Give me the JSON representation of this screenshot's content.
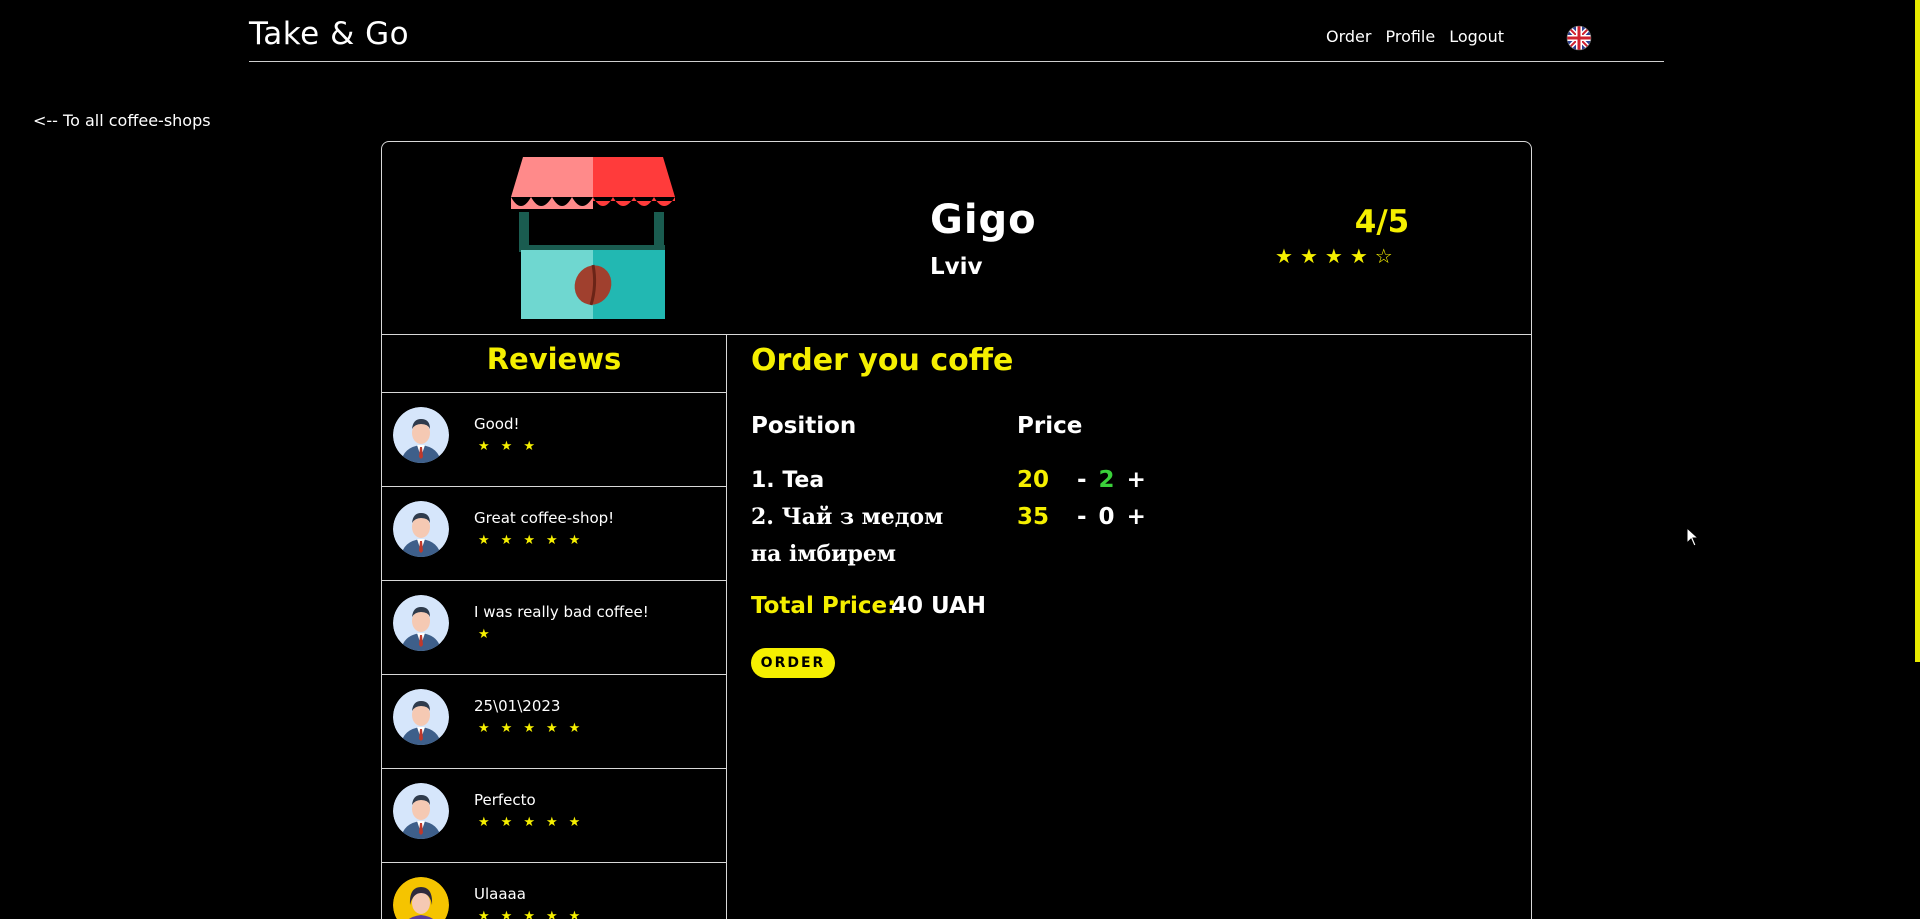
{
  "header": {
    "brand": "Take & Go",
    "nav": [
      "Order",
      "Profile",
      "Logout"
    ],
    "language_icon": "uk-flag-icon"
  },
  "back_link": "<-- To all coffee-shops",
  "shop": {
    "name": "Gigo",
    "city": "Lviv",
    "rating_text": "4/5",
    "rating_value": 4,
    "rating_max": 5,
    "illustration": "coffee-stall-icon"
  },
  "reviews": {
    "title": "Reviews",
    "items": [
      {
        "text": "Good!",
        "stars": 3,
        "avatar": "man-avatar"
      },
      {
        "text": "Great coffee-shop!",
        "stars": 5,
        "avatar": "man-avatar"
      },
      {
        "text": "I was really bad coffee!",
        "stars": 1,
        "avatar": "man-avatar"
      },
      {
        "text": "25\\01\\2023",
        "stars": 5,
        "avatar": "man-avatar"
      },
      {
        "text": "Perfecto",
        "stars": 5,
        "avatar": "man-avatar"
      },
      {
        "text": "Ulaaaa",
        "stars": 5,
        "avatar": "woman-avatar"
      }
    ]
  },
  "order": {
    "title": "Order you coffe",
    "col_position": "Position",
    "col_price": "Price",
    "items": [
      {
        "name": "1. Tea",
        "price": "20",
        "qty": "2",
        "minus": "-",
        "plus": "+"
      },
      {
        "name": "2. Чай з медом на імбирем",
        "price": "35",
        "qty": "0",
        "minus": "-",
        "plus": "+"
      }
    ],
    "total_label": "Total Price:",
    "total_value": "40 UAH",
    "order_button": "ORDER"
  },
  "colors": {
    "accent": "#f5ef00",
    "qty_active": "#3ad13a",
    "background": "#000000"
  }
}
